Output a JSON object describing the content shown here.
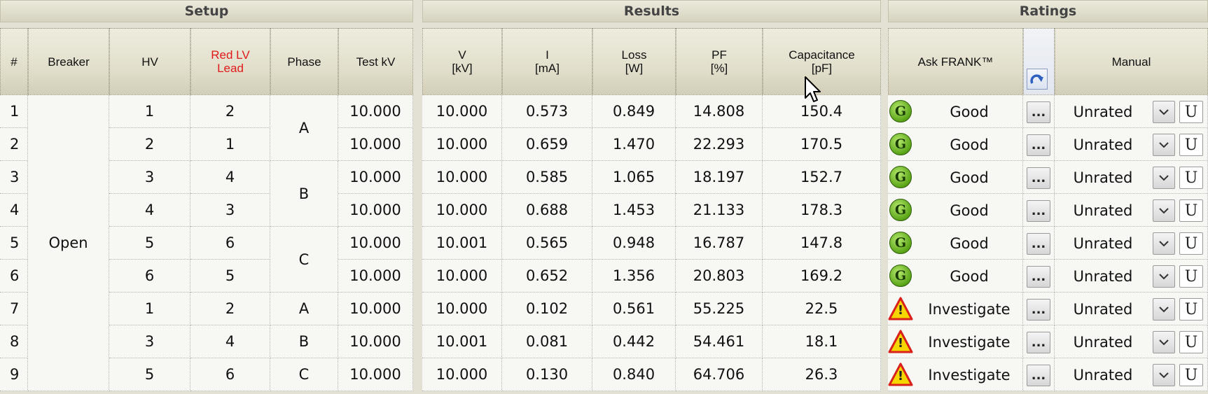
{
  "groups": {
    "setup": "Setup",
    "results": "Results",
    "ratings": "Ratings"
  },
  "headers": {
    "num": "#",
    "breaker": "Breaker",
    "hv": "HV",
    "red_lv_lead_1": "Red LV",
    "red_lv_lead_2": "Lead",
    "phase": "Phase",
    "test_kv": "Test kV",
    "v_1": "V",
    "v_2": "[kV]",
    "i_1": "I",
    "i_2": "[mA]",
    "loss_1": "Loss",
    "loss_2": "[W]",
    "pf_1": "PF",
    "pf_2": "[%]",
    "cap_1": "Capacitance",
    "cap_2": "[pF]",
    "ask_frank": "Ask FRANK™",
    "manual": "Manual"
  },
  "breaker_state": "Open",
  "phases": [
    "A",
    "B",
    "C",
    "A",
    "B",
    "C"
  ],
  "colors": {
    "good_icon": "#5aa417",
    "warning_icon": "#f5d600",
    "red_lead_header": "#e01a1a"
  },
  "rows": [
    {
      "n": "1",
      "hv": "1",
      "lv": "2",
      "test_kv": "10.000",
      "v": "10.000",
      "i": "0.573",
      "loss": "0.849",
      "pf": "14.808",
      "cap": "150.4",
      "icon": "good",
      "icon_letter": "G",
      "rating": "Good",
      "more": "...",
      "manual": "Unrated",
      "u": "U"
    },
    {
      "n": "2",
      "hv": "2",
      "lv": "1",
      "test_kv": "10.000",
      "v": "10.000",
      "i": "0.659",
      "loss": "1.470",
      "pf": "22.293",
      "cap": "170.5",
      "icon": "good",
      "icon_letter": "G",
      "rating": "Good",
      "more": "...",
      "manual": "Unrated",
      "u": "U"
    },
    {
      "n": "3",
      "hv": "3",
      "lv": "4",
      "test_kv": "10.000",
      "v": "10.000",
      "i": "0.585",
      "loss": "1.065",
      "pf": "18.197",
      "cap": "152.7",
      "icon": "good",
      "icon_letter": "G",
      "rating": "Good",
      "more": "...",
      "manual": "Unrated",
      "u": "U"
    },
    {
      "n": "4",
      "hv": "4",
      "lv": "3",
      "test_kv": "10.000",
      "v": "10.000",
      "i": "0.688",
      "loss": "1.453",
      "pf": "21.133",
      "cap": "178.3",
      "icon": "good",
      "icon_letter": "G",
      "rating": "Good",
      "more": "...",
      "manual": "Unrated",
      "u": "U"
    },
    {
      "n": "5",
      "hv": "5",
      "lv": "6",
      "test_kv": "10.000",
      "v": "10.001",
      "i": "0.565",
      "loss": "0.948",
      "pf": "16.787",
      "cap": "147.8",
      "icon": "good",
      "icon_letter": "G",
      "rating": "Good",
      "more": "...",
      "manual": "Unrated",
      "u": "U"
    },
    {
      "n": "6",
      "hv": "6",
      "lv": "5",
      "test_kv": "10.000",
      "v": "10.000",
      "i": "0.652",
      "loss": "1.356",
      "pf": "20.803",
      "cap": "169.2",
      "icon": "good",
      "icon_letter": "G",
      "rating": "Good",
      "more": "...",
      "manual": "Unrated",
      "u": "U"
    },
    {
      "n": "7",
      "hv": "1",
      "lv": "2",
      "test_kv": "10.000",
      "v": "10.000",
      "i": "0.102",
      "loss": "0.561",
      "pf": "55.225",
      "cap": "22.5",
      "icon": "warning",
      "icon_letter": "!",
      "rating": "Investigate",
      "more": "...",
      "manual": "Unrated",
      "u": "U"
    },
    {
      "n": "8",
      "hv": "3",
      "lv": "4",
      "test_kv": "10.000",
      "v": "10.001",
      "i": "0.081",
      "loss": "0.442",
      "pf": "54.461",
      "cap": "18.1",
      "icon": "warning",
      "icon_letter": "!",
      "rating": "Investigate",
      "more": "...",
      "manual": "Unrated",
      "u": "U"
    },
    {
      "n": "9",
      "hv": "5",
      "lv": "6",
      "test_kv": "10.000",
      "v": "10.000",
      "i": "0.130",
      "loss": "0.840",
      "pf": "64.706",
      "cap": "26.3",
      "icon": "warning",
      "icon_letter": "!",
      "rating": "Investigate",
      "more": "...",
      "manual": "Unrated",
      "u": "U"
    }
  ]
}
